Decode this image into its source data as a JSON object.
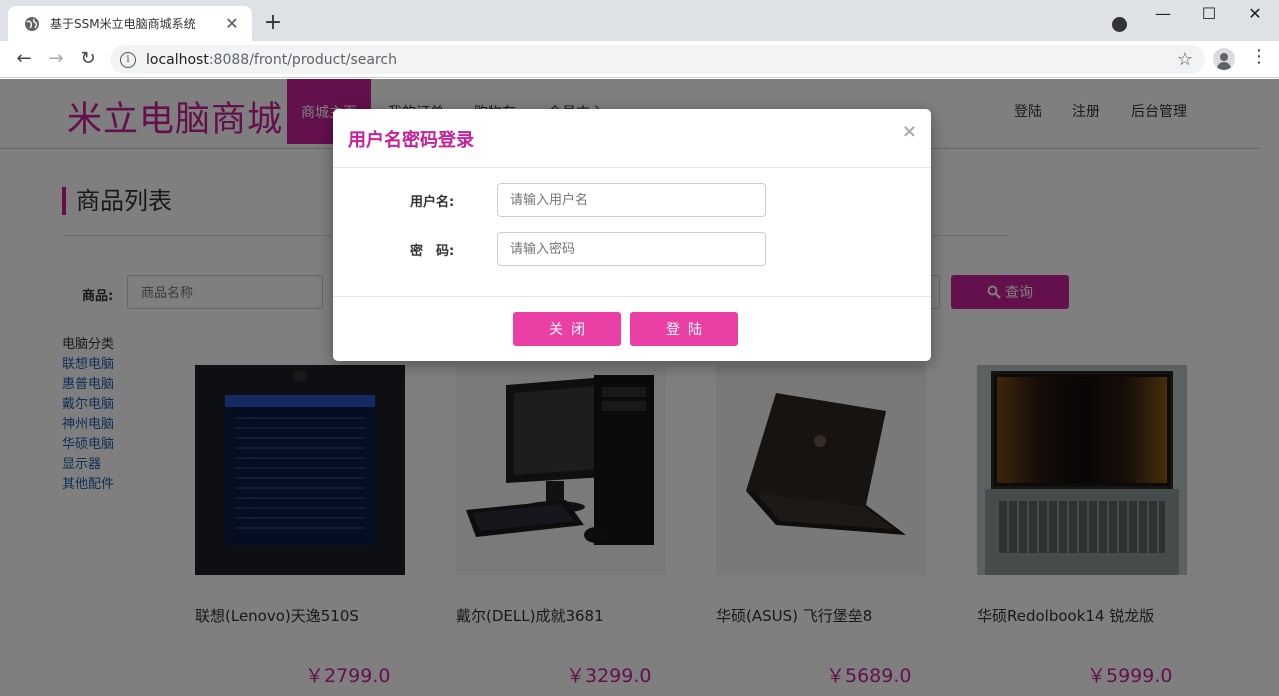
{
  "browser": {
    "tab_title": "基于SSM米立电脑商城系统",
    "new_tab": "+",
    "url_host": "localhost",
    "url_path": ":8088/front/product/search",
    "window_controls": [
      "—",
      "☐",
      "✕"
    ]
  },
  "header": {
    "logo": "米立电脑商城",
    "nav": [
      "商城主页",
      "我的订单",
      "购物车",
      "会员中心"
    ],
    "links": [
      "登陆",
      "注册",
      "后台管理"
    ]
  },
  "main": {
    "section_title": "商品列表",
    "search": {
      "label": "商品:",
      "placeholder": "商品名称",
      "button": "查询"
    },
    "categories": {
      "title": "电脑分类",
      "items": [
        "联想电脑",
        "惠普电脑",
        "戴尔电脑",
        "神州电脑",
        "华硕电脑",
        "显示器",
        "其他配件"
      ]
    },
    "products": [
      {
        "name": "联想(Lenovo)天逸510S",
        "price": "￥2799.0"
      },
      {
        "name": "戴尔(DELL)成就3681",
        "price": "￥3299.0"
      },
      {
        "name": "华硕(ASUS) 飞行堡垒8",
        "price": "￥5689.0"
      },
      {
        "name": "华硕Redolbook14 锐龙版",
        "price": "￥5999.0"
      }
    ]
  },
  "modal": {
    "title": "用户名密码登录",
    "close_glyph": "×",
    "username_label": "用户名:",
    "username_placeholder": "请输入用户名",
    "password_label": "密　码:",
    "password_placeholder": "请输入密码",
    "close_button": "关闭",
    "login_button": "登陆"
  },
  "colors": {
    "brand": "#c8209a",
    "button": "#ea3fa5",
    "link": "#1f5ca8"
  }
}
